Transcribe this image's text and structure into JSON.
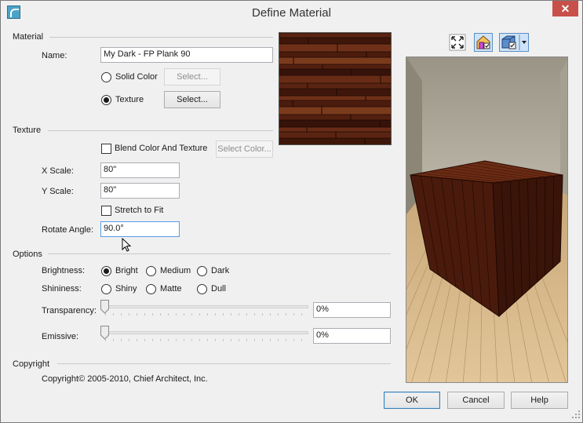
{
  "window": {
    "title": "Define Material"
  },
  "material": {
    "section_label": "Material",
    "name_label": "Name:",
    "name_value": "My Dark - FP Plank 90",
    "solid_color_label": "Solid Color",
    "solid_select_label": "Select...",
    "texture_label": "Texture",
    "texture_select_label": "Select...",
    "selected_type": "Texture"
  },
  "texture": {
    "section_label": "Texture",
    "blend_label": "Blend Color And Texture",
    "blend_checked": false,
    "select_color_label": "Select Color...",
    "x_scale_label": "X Scale:",
    "x_scale_value": "80\"",
    "y_scale_label": "Y Scale:",
    "y_scale_value": "80\"",
    "stretch_label": "Stretch to Fit",
    "stretch_checked": false,
    "rotate_label": "Rotate Angle:",
    "rotate_value": "90.0°"
  },
  "options": {
    "section_label": "Options",
    "brightness_label": "Brightness:",
    "brightness_choices": [
      "Bright",
      "Medium",
      "Dark"
    ],
    "brightness_selected": "Bright",
    "shininess_label": "Shininess:",
    "shininess_choices": [
      "Shiny",
      "Matte",
      "Dull"
    ],
    "shininess_selected": null,
    "transparency_label": "Transparency:",
    "transparency_value": "0%",
    "transparency_level": 0,
    "emissive_label": "Emissive:",
    "emissive_value": "0%",
    "emissive_level": 0
  },
  "copyright": {
    "section_label": "Copyright",
    "text": "Copyright© 2005-2010, Chief Architect, Inc."
  },
  "preview_toolbar": {
    "icons": [
      "fit-view-icon",
      "room-box-toggle-icon",
      "cube-view-icon",
      "dropdown-arrow-icon"
    ]
  },
  "buttons": {
    "ok": "OK",
    "cancel": "Cancel",
    "help": "Help"
  },
  "colors": {
    "accent": "#3c7fb1",
    "close": "#c7504a",
    "wood_dark": "#3d1a0e",
    "wood_light": "#7a3a1c"
  }
}
